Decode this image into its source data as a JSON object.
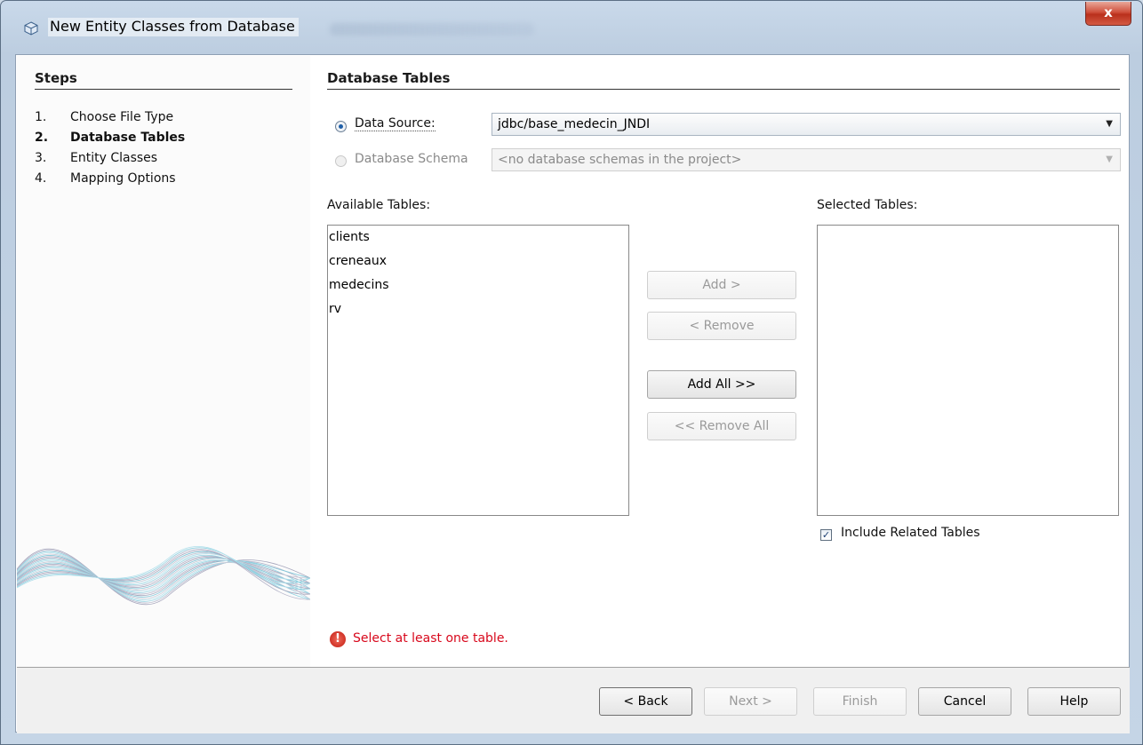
{
  "window": {
    "title": "New Entity Classes from Database",
    "close_label": "x"
  },
  "steps": {
    "heading": "Steps",
    "items": [
      {
        "num": "1.",
        "label": "Choose File Type"
      },
      {
        "num": "2.",
        "label": "Database Tables"
      },
      {
        "num": "3.",
        "label": "Entity Classes"
      },
      {
        "num": "4.",
        "label": "Mapping Options"
      }
    ],
    "current": 2
  },
  "panel": {
    "heading": "Database Tables",
    "data_source_label": "Data Source:",
    "data_source_value": "jdbc/base_medecin_JNDI",
    "schema_label": "Database Schema",
    "schema_value": "<no database schemas in the project>",
    "available_label": "Available Tables:",
    "available_tables": [
      "clients",
      "creneaux",
      "medecins",
      "rv"
    ],
    "selected_label": "Selected Tables:",
    "selected_tables": [],
    "add_label": "Add >",
    "remove_label": "< Remove",
    "add_all_label": "Add All >>",
    "remove_all_label": "<< Remove All",
    "include_related_label": "Include Related Tables",
    "include_related_checked": true,
    "error_message": "Select at least one table."
  },
  "footer": {
    "back_label": "< Back",
    "next_label": "Next >",
    "finish_label": "Finish",
    "cancel_label": "Cancel",
    "help_label": "Help"
  },
  "colors": {
    "error": "#d8081c",
    "accent": "#1f5fa8"
  }
}
